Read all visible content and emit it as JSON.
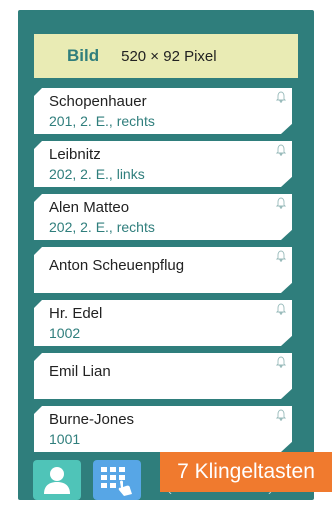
{
  "banner": {
    "label": "Bild",
    "size": "520 × 92 Pixel"
  },
  "entries": [
    {
      "name": "Schopenhauer",
      "sub": "201, 2. E., rechts"
    },
    {
      "name": "Leibnitz",
      "sub": "202, 2. E., links"
    },
    {
      "name": "Alen Matteo",
      "sub": "202, 2. E., rechts"
    },
    {
      "name": "Anton Scheuenpflug",
      "sub": ""
    },
    {
      "name": "Hr. Edel",
      "sub": "1002"
    },
    {
      "name": "Emil Lian",
      "sub": ""
    },
    {
      "name": "Burne-Jones",
      "sub": "1001"
    }
  ],
  "nav": {
    "user_icon": "user-icon",
    "keypad_icon": "keypad-hand-icon",
    "prev_icon": "chevron-left-icon",
    "next_icon": "chevron-right-icon"
  },
  "caption": "7 Klingeltasten",
  "colors": {
    "background": "#2f7e7c",
    "banner": "#e9ebb4",
    "accent": "#2f7e7c",
    "caption": "#f07a2e",
    "user_button": "#4fc4b8",
    "keypad_button": "#57a6e6"
  }
}
